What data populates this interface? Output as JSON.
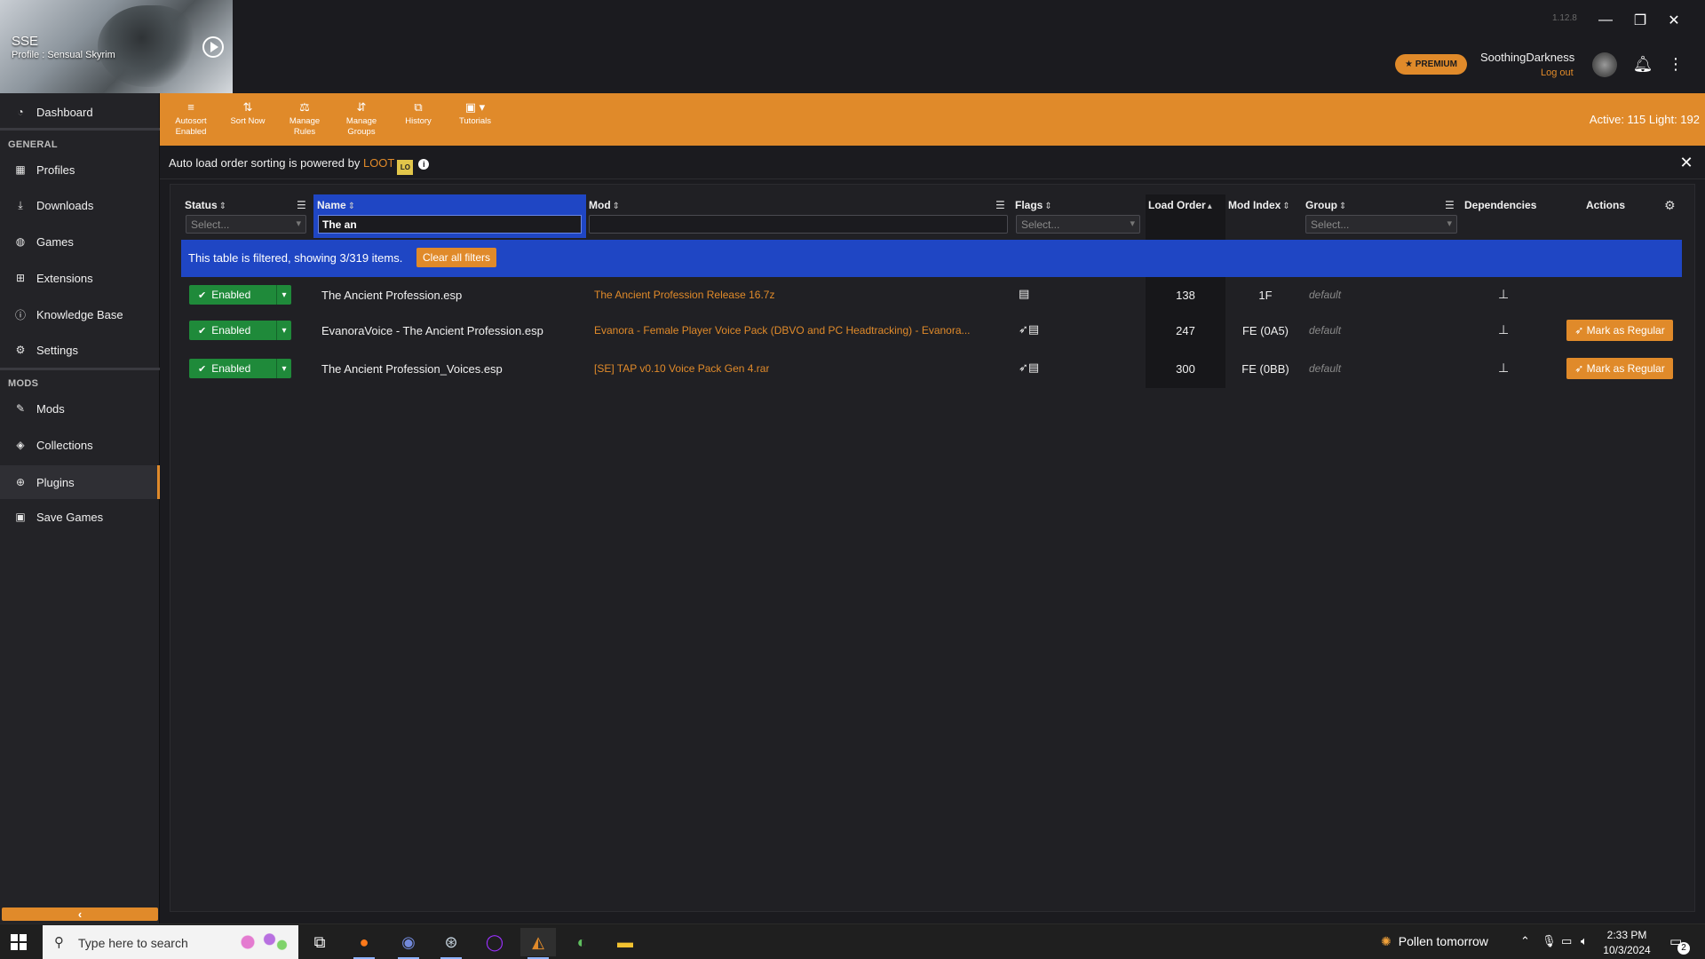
{
  "app": {
    "version": "1.12.8",
    "game_abbr": "SSE",
    "profile": "Profile : Sensual Skyrim",
    "premium_label": "★ PREMIUM",
    "username": "SoothingDarkness",
    "logout_label": "Log out",
    "accent_color": "#e08a2a",
    "highlight_color": "#1f46c4"
  },
  "sidebar": {
    "dashboard": "Dashboard",
    "general_label": "GENERAL",
    "general_items": [
      "Profiles",
      "Downloads",
      "Games",
      "Extensions",
      "Knowledge Base",
      "Settings"
    ],
    "mods_label": "MODS",
    "mods_items": [
      "Mods",
      "Collections",
      "Plugins",
      "Save Games"
    ],
    "active_item": "Plugins"
  },
  "toolbar": {
    "buttons": [
      {
        "label1": "Autosort",
        "label2": "Enabled",
        "icon": "autosort-icon"
      },
      {
        "label1": "Sort Now",
        "label2": "",
        "icon": "sort-icon"
      },
      {
        "label1": "Manage",
        "label2": "Rules",
        "icon": "rules-icon"
      },
      {
        "label1": "Manage",
        "label2": "Groups",
        "icon": "groups-icon"
      },
      {
        "label1": "History",
        "label2": "",
        "icon": "history-icon"
      },
      {
        "label1": "Tutorials",
        "label2": "",
        "icon": "tutorials-icon"
      }
    ],
    "active_count": "Active: 115 Light: 192"
  },
  "info": {
    "text": "Auto load order sorting is powered by ",
    "link": "LOOT",
    "logo_text": "LO"
  },
  "table": {
    "headers": {
      "status": "Status",
      "name": "Name",
      "mod": "Mod",
      "flags": "Flags",
      "load_order": "Load Order",
      "mod_index": "Mod Index",
      "group": "Group",
      "dependencies": "Dependencies",
      "actions": "Actions"
    },
    "filters": {
      "status_placeholder": "Select...",
      "name_value": "The an",
      "flags_placeholder": "Select...",
      "group_placeholder": "Select..."
    },
    "filtered_text": "This table is filtered, showing 3/319 items.",
    "clear_filters": "Clear all filters",
    "rows": [
      {
        "status": "Enabled",
        "name": "The Ancient Profession.esp",
        "mod": "The Ancient Profession Release 16.7z",
        "flags": "▤",
        "load_order": "138",
        "mod_index": "1F",
        "group": "default",
        "action": ""
      },
      {
        "status": "Enabled",
        "name": "EvanoraVoice - The Ancient Profession.esp",
        "mod": "Evanora - Female Player Voice Pack (DBVO and PC Headtracking) - Evanora...",
        "flags": "➶▤",
        "load_order": "247",
        "mod_index": "FE (0A5)",
        "group": "default",
        "action": "Mark as Regular"
      },
      {
        "status": "Enabled",
        "name": "The Ancient Profession_Voices.esp",
        "mod": "[SE] TAP v0.10 Voice Pack Gen 4.rar",
        "flags": "➶▤",
        "load_order": "300",
        "mod_index": "FE (0BB)",
        "group": "default",
        "action": "Mark as Regular"
      }
    ]
  },
  "taskbar": {
    "search_placeholder": "Type here to search",
    "weather": "Pollen tomorrow",
    "time": "2:33 PM",
    "date": "10/3/2024",
    "notifications": "2"
  }
}
